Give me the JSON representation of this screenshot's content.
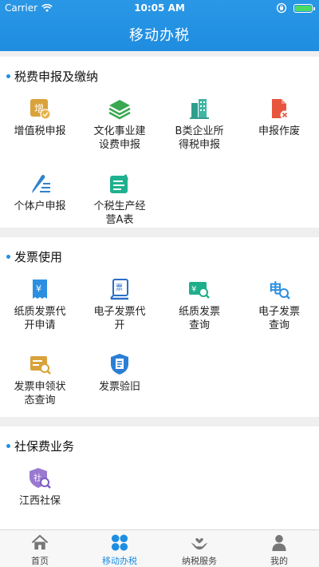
{
  "status_bar": {
    "carrier": "Carrier",
    "time": "10:05 AM",
    "battery_level": 1.0
  },
  "nav": {
    "title": "移动办税"
  },
  "sections": [
    {
      "title": "税费申报及缴纳",
      "items": [
        {
          "label": "增值税申报",
          "icon": "vat-stamp-icon"
        },
        {
          "label": "文化事业建\n设费申报",
          "icon": "layers-icon"
        },
        {
          "label": "B类企业所\n得税申报",
          "icon": "buildings-icon"
        },
        {
          "label": "申报作废",
          "icon": "document-cancel-icon"
        },
        {
          "label": "个体户申报",
          "icon": "pen-lines-icon"
        },
        {
          "label": "个税生产经\n营A表",
          "icon": "form-a-icon"
        }
      ]
    },
    {
      "title": "发票使用",
      "items": [
        {
          "label": "纸质发票代\n开申请",
          "icon": "paper-invoice-icon"
        },
        {
          "label": "电子发票代\n开",
          "icon": "e-invoice-icon"
        },
        {
          "label": "纸质发票\n查询",
          "icon": "invoice-search-icon"
        },
        {
          "label": "电子发票\n查询",
          "icon": "e-invoice-search-icon"
        },
        {
          "label": "发票申领状\n态查询",
          "icon": "invoice-status-icon"
        },
        {
          "label": "发票验旧",
          "icon": "invoice-verify-icon"
        }
      ]
    },
    {
      "title": "社保费业务",
      "items": [
        {
          "label": "江西社保",
          "icon": "social-security-icon"
        }
      ]
    }
  ],
  "tabs": [
    {
      "label": "首页",
      "icon": "home-icon",
      "active": false
    },
    {
      "label": "移动办税",
      "icon": "grid-dots-icon",
      "active": true
    },
    {
      "label": "纳税服务",
      "icon": "hands-heart-icon",
      "active": false
    },
    {
      "label": "我的",
      "icon": "person-icon",
      "active": false
    }
  ],
  "colors": {
    "brand": "#1f8de0",
    "active_tab": "#1e8ee2"
  }
}
